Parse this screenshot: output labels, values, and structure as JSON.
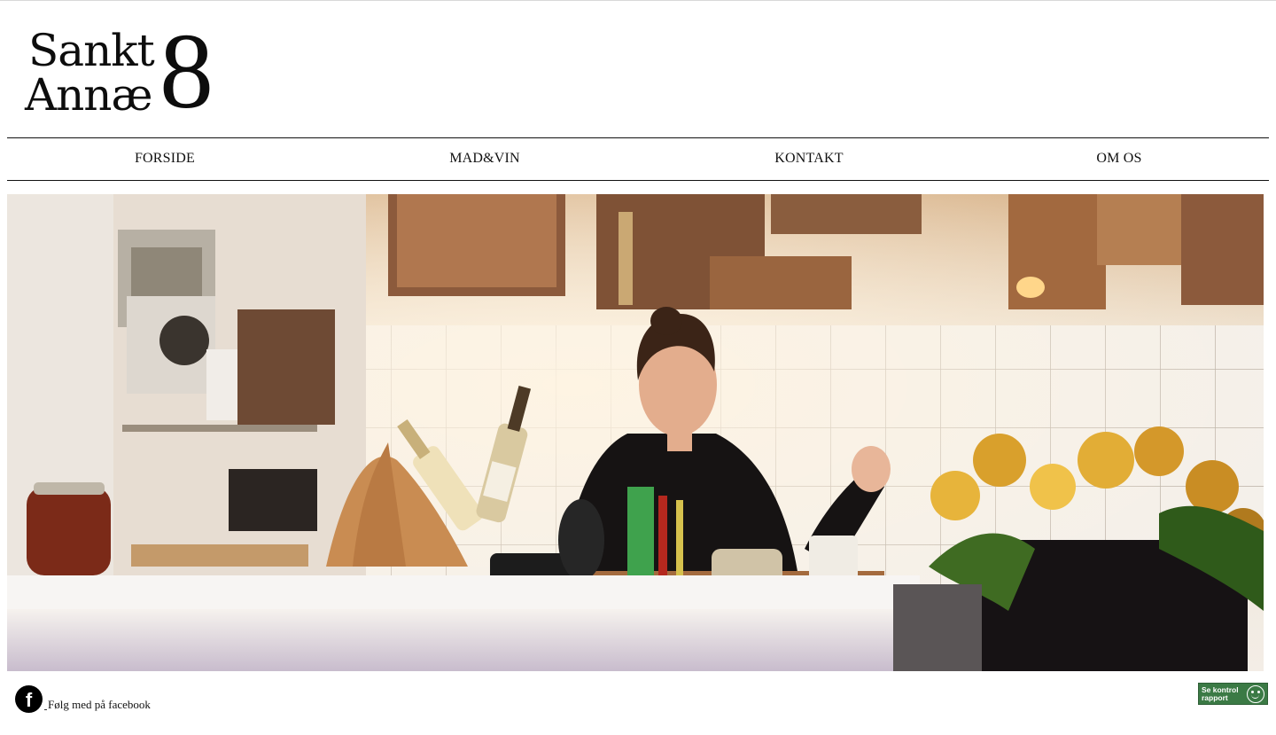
{
  "logo": {
    "line1": "Sankt",
    "line2": "Annæ",
    "number": "8"
  },
  "nav": {
    "items": [
      {
        "label": "FORSIDE"
      },
      {
        "label": "MAD&VIN"
      },
      {
        "label": "KONTAKT"
      },
      {
        "label": "OM OS"
      }
    ]
  },
  "footer": {
    "facebook_icon": "f",
    "facebook_label": "Følg med på facebook",
    "badge": {
      "line1": "Se kontrol",
      "line2": "rapport",
      "icon": "smiley-icon",
      "color": "#3b7a45"
    }
  }
}
